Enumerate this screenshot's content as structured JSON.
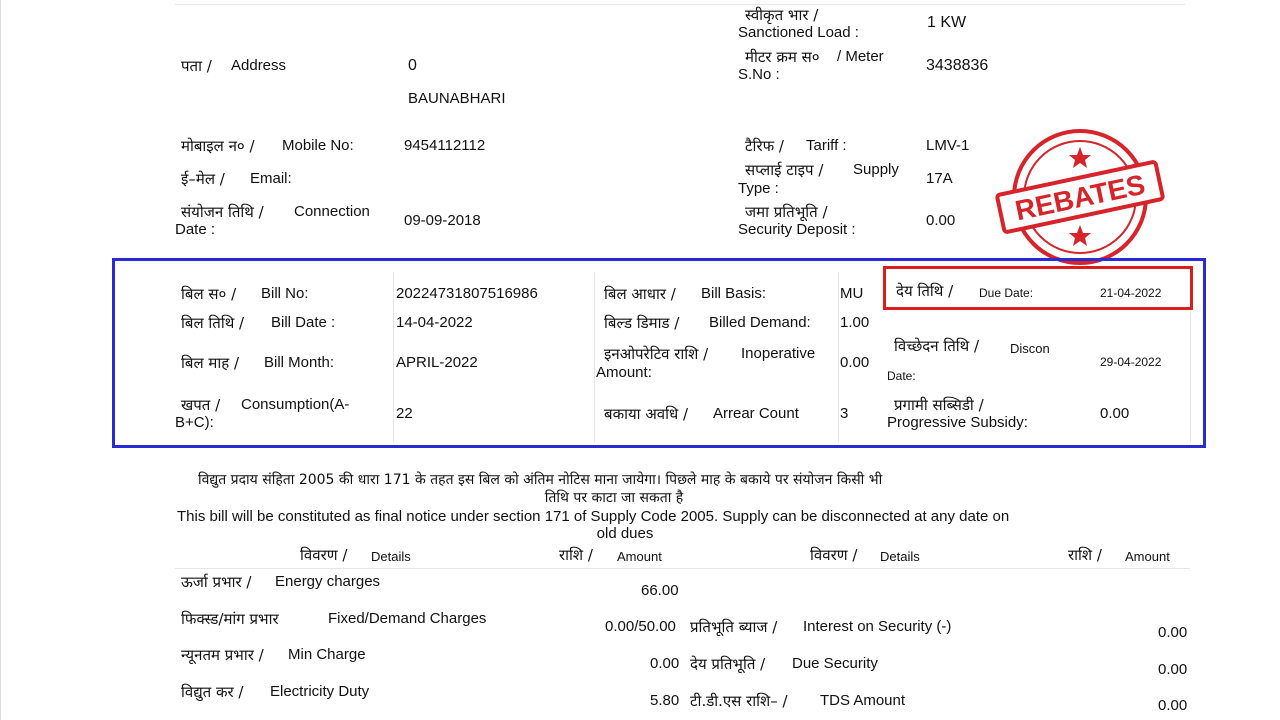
{
  "top": {
    "sanctioned_hi": "स्वीकृत भार /",
    "sanctioned_en": "Sanctioned Load :",
    "sanctioned_val": "1  KW",
    "address_hi": "पता /",
    "address_en": "Address",
    "address_val1": "0",
    "address_val2": "BAUNABHARI",
    "meter_hi": "मीटर क्रम स०",
    "meter_en1": "/   Meter",
    "meter_en2": "S.No :",
    "meter_val": "3438836",
    "mobile_hi": "मोबाइल न० /",
    "mobile_en": "Mobile No:",
    "mobile_val": "9454112112",
    "tariff_hi": "टैरिफ /",
    "tariff_en": "Tariff :",
    "tariff_val": "LMV-1",
    "email_hi": "ई–मेल /",
    "email_en": "Email:",
    "supply_hi": "सप्लाई टाइप /",
    "supply_en1": "Supply",
    "supply_en2": "Type :",
    "supply_val": "17A",
    "conn_hi": "संयोजन तिथि /",
    "conn_en1": "Connection",
    "conn_en2": "Date :",
    "conn_val": "09-09-2018",
    "sec_hi": "जमा प्रतिभूति /",
    "sec_en": "Security Deposit :",
    "sec_val": "0.00"
  },
  "stamp": {
    "text": "REBATES",
    "colors": {
      "red": "#d8232a"
    }
  },
  "bill": {
    "billno_hi": "बिल स० /",
    "billno_en": "Bill No:",
    "billno_val": "20224731807516986",
    "basis_hi": "बिल आधार /",
    "basis_en": "Bill Basis:",
    "basis_val": "MU",
    "due_hi": "देय तिथि /",
    "due_en": "Due Date:",
    "due_val": "21-04-2022",
    "billdate_hi": "बिल तिथि /",
    "billdate_en": "Bill Date :",
    "billdate_val": "14-04-2022",
    "demand_hi": "बिल्ड डिमाड /",
    "demand_en": "Billed Demand:",
    "demand_val": "1.00",
    "disc_hi": "विच्छेदन तिथि /",
    "disc_en1": "Discon",
    "disc_en2": "Date:",
    "disc_val": "29-04-2022",
    "month_hi": "बिल माह /",
    "month_en": "Bill Month:",
    "month_val": "APRIL-2022",
    "inop_hi": "इनओपरेटिव राशि /",
    "inop_en1": "Inoperative",
    "inop_en2": "Amount:",
    "inop_val": "0.00",
    "cons_hi": "खपत /",
    "cons_en1": "Consumption(A-",
    "cons_en2": "B+C):",
    "cons_val": "22",
    "arrear_hi": "बकाया अवधि /",
    "arrear_en": "Arrear Count",
    "arrear_val": "3",
    "prog_hi": "प्रगामी सब्सिडी /",
    "prog_en": "Progressive Subsidy:",
    "prog_val": "0.00"
  },
  "notice": {
    "hi1": "विद्युत प्रदाय संहिता 2005 की धारा 171 के तहत इस बिल को अंतिम नोटिस माना जायेगा। पिछले माह के बकाये पर संयोजन किसी भी",
    "hi2": "तिथि पर काटा जा सकता है",
    "en1": "This bill will be constituted as final notice under section 171 of Supply Code 2005. Supply can be disconnected at any date on",
    "en2": "old dues"
  },
  "charges": {
    "hdr_details_hi": "विवरण /",
    "hdr_details_en": "Details",
    "hdr_amount_hi": "राशि /",
    "hdr_amount_en": "Amount",
    "left": [
      {
        "hi": "ऊर्जा प्रभार /",
        "en": "Energy charges",
        "amount": "66.00"
      },
      {
        "hi": "फिक्स्ड/मांग प्रभार",
        "en": "Fixed/Demand Charges",
        "amount": "0.00/50.00"
      },
      {
        "hi": "न्यूनतम प्रभार /",
        "en": "Min Charge",
        "amount": "0.00"
      },
      {
        "hi": "विद्युत कर /",
        "en": "Electricity Duty",
        "amount": "5.80"
      }
    ],
    "right": [
      {
        "hi": "प्रतिभूति ब्याज /",
        "en": "Interest on Security (-)",
        "amount": "0.00"
      },
      {
        "hi": "देय प्रतिभूति /",
        "en": "Due Security",
        "amount": "0.00"
      },
      {
        "hi": "टी.डी.एस राशि– /",
        "en": "TDS Amount",
        "amount": "0.00"
      }
    ]
  }
}
